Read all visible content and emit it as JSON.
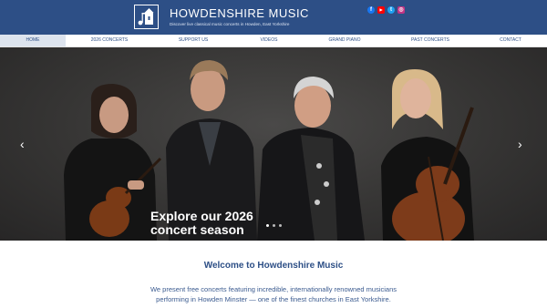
{
  "site": {
    "title": "HOWDENSHIRE MUSIC",
    "tagline": "Discover live classical music concerts in Howden, East Yorkshire"
  },
  "social": [
    {
      "icon": "facebook-icon",
      "glyph": "f",
      "color": "#1877f2"
    },
    {
      "icon": "youtube-icon",
      "glyph": "▶",
      "color": "#ff0000"
    },
    {
      "icon": "twitter-icon",
      "glyph": "t",
      "color": "#1da1f2"
    },
    {
      "icon": "instagram-icon",
      "glyph": "◎",
      "color": "#c13584"
    }
  ],
  "nav": {
    "items": [
      "HOME",
      "2026 CONCERTS",
      "SUPPORT US",
      "VIDEOS",
      "GRAND PIANO",
      "PAST CONCERTS",
      "CONTACT"
    ],
    "active": "HOME"
  },
  "hero": {
    "line1": "Explore our 2026",
    "line2": "concert season",
    "prev_icon": "chevron-left-icon",
    "next_icon": "chevron-right-icon",
    "slide_count": 3,
    "active_slide": 1
  },
  "welcome": {
    "title": "Welcome to Howdenshire Music",
    "line1": "We present free concerts featuring incredible, internationally renowned musicians",
    "line2": "performing in Howden Minster — one of the finest churches in East Yorkshire."
  },
  "colors": {
    "brand_blue": "#2d4f86",
    "nav_active_bg": "#dde4ee"
  }
}
